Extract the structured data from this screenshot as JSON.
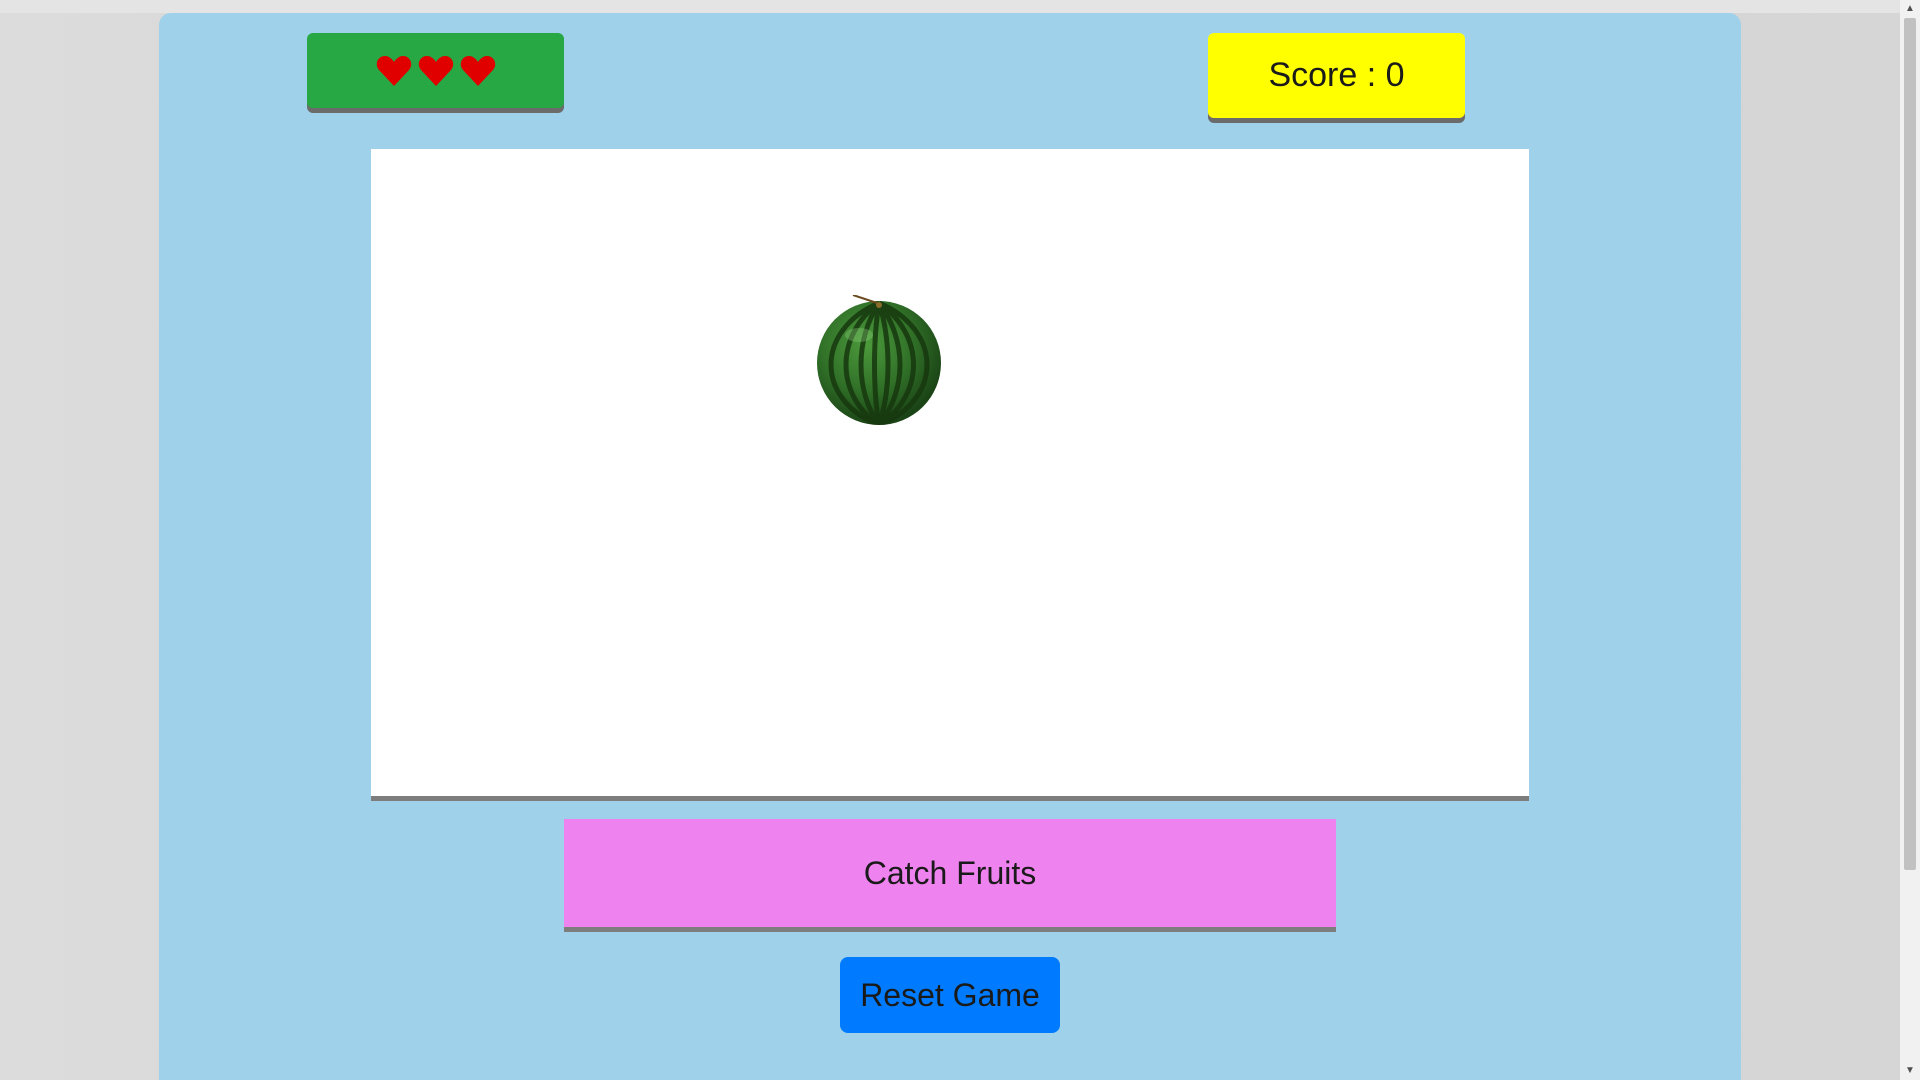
{
  "game": {
    "lives": 3,
    "score_label": "Score : 0",
    "title": "Catch Fruits",
    "reset_label": "Reset Game",
    "fruit": "watermelon"
  },
  "colors": {
    "container_bg": "#9fd2ea",
    "lives_bg": "#28a745",
    "heart": "#e00000",
    "score_bg": "#ffff00",
    "title_bg": "#ee82ee",
    "reset_bg": "#007bff"
  },
  "icons": {
    "life": "heart-icon",
    "fruit": "watermelon-icon",
    "scroll_up": "chevron-up-icon",
    "scroll_down": "chevron-down-icon"
  }
}
